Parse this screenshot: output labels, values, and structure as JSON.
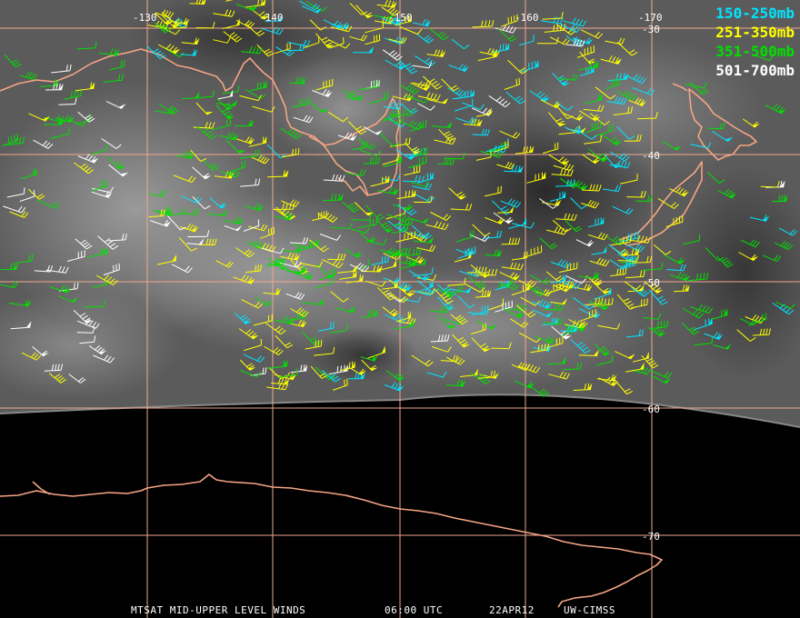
{
  "colors": {
    "grid": "#f0a890",
    "coast": "#f4a584",
    "c150": "#00e5ff",
    "c251": "#ffff00",
    "c351": "#00e000",
    "c501": "#ffffff"
  },
  "legend": [
    {
      "label": "150-250mb",
      "color": "#00e5ff"
    },
    {
      "label": "251-350mb",
      "color": "#ffff00"
    },
    {
      "label": "351-500mb",
      "color": "#00e000"
    },
    {
      "label": "501-700mb",
      "color": "#ffffff"
    }
  ],
  "lon_labels": [
    "-130",
    "-140",
    "-150",
    "-160",
    "-170"
  ],
  "lat_labels": [
    "-30",
    "-40",
    "-50",
    "-60",
    "-70"
  ],
  "footer": {
    "product": "MTSAT MID-UPPER LEVEL WINDS",
    "time": "06:00 UTC",
    "date": "22APR12",
    "source": "UW-CIMSS"
  }
}
